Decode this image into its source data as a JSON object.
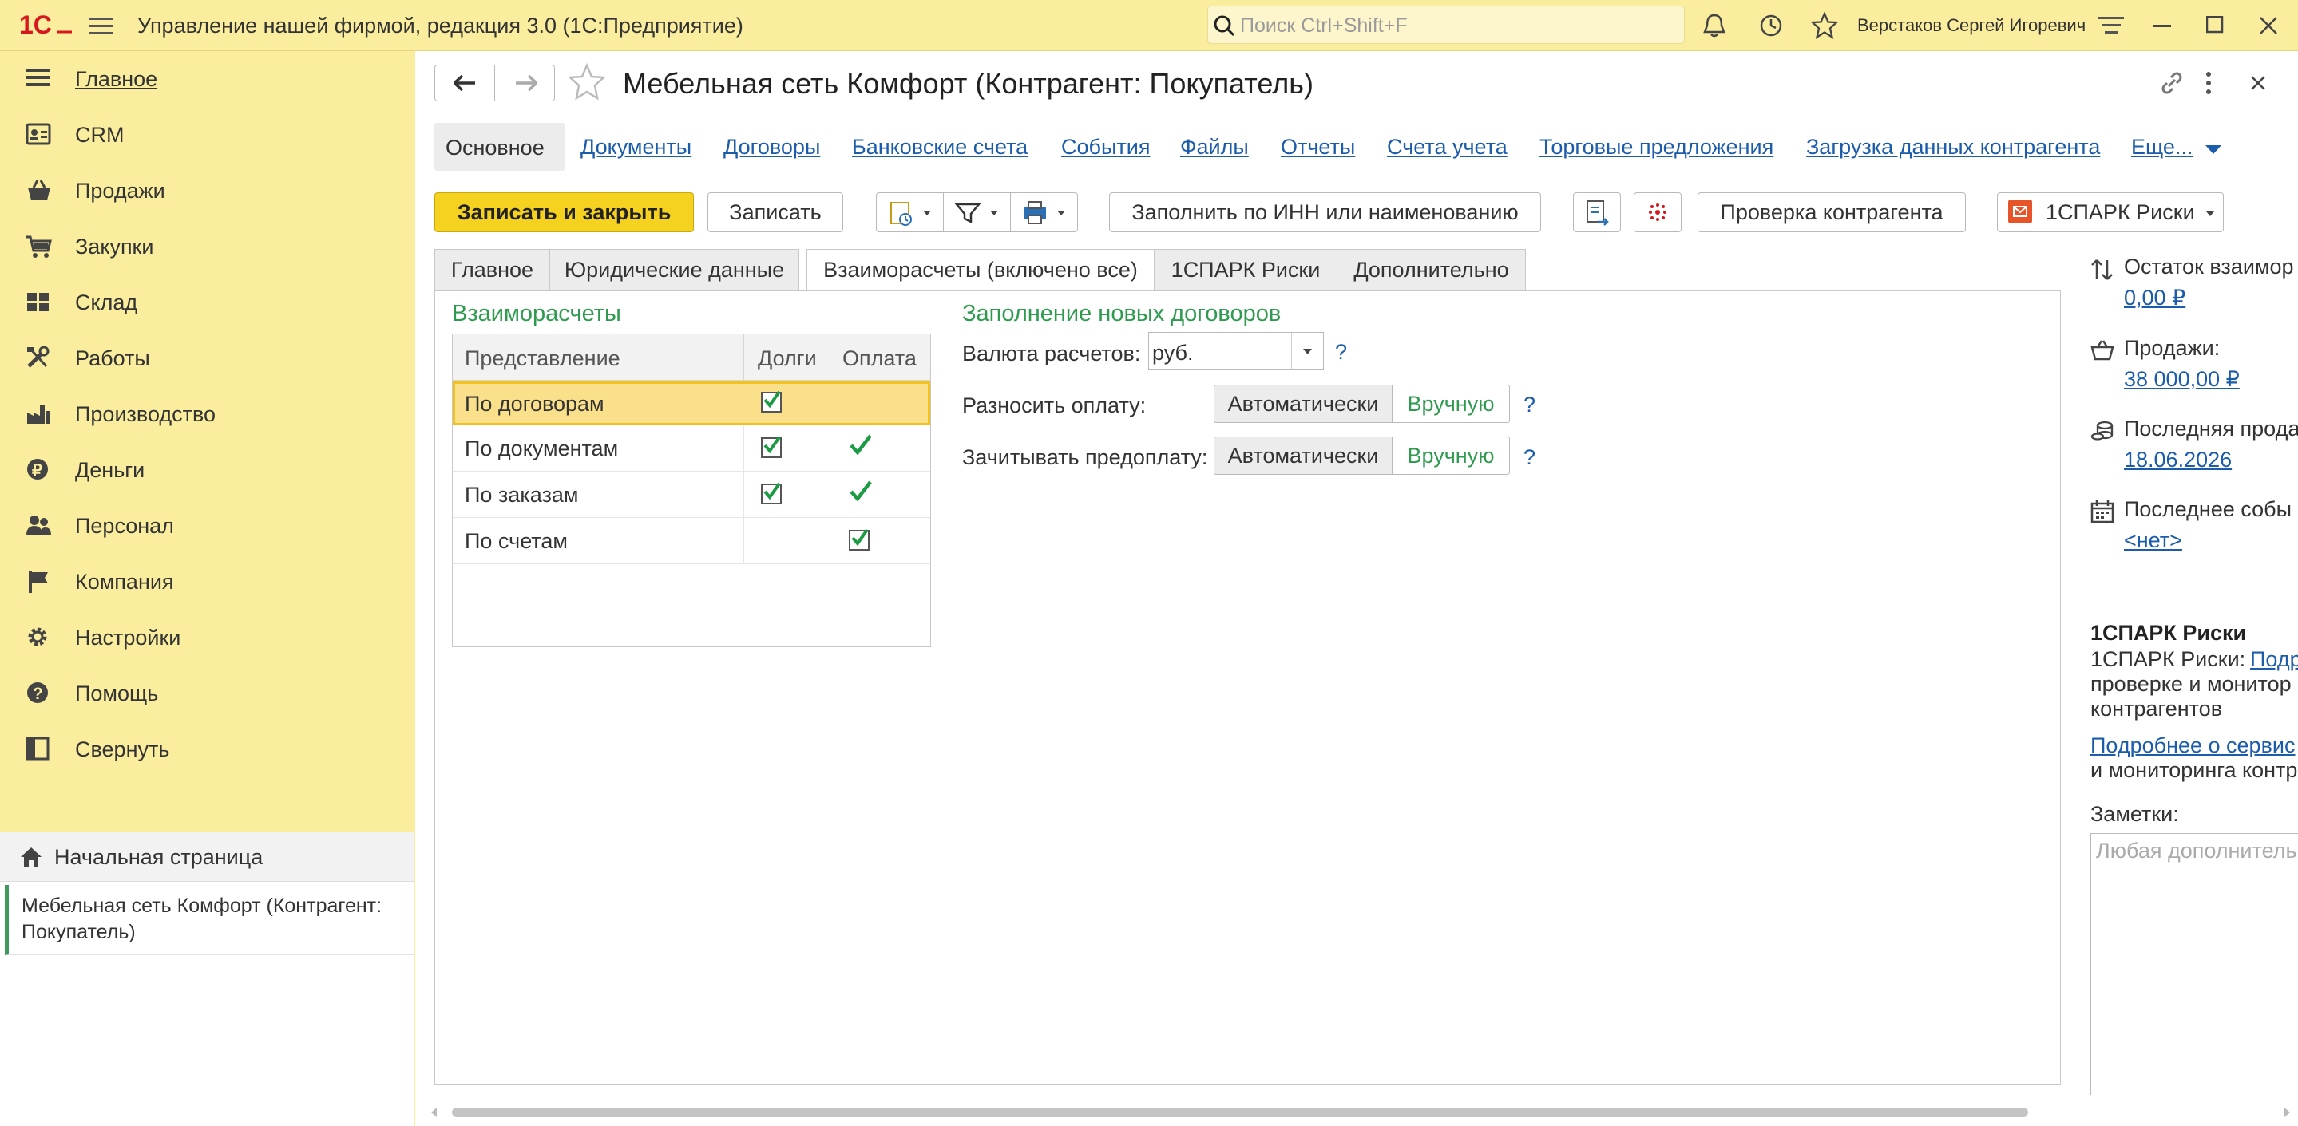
{
  "titlebar": {
    "logo": "1С",
    "app_title": "Управление нашей фирмой, редакция 3.0  (1С:Предприятие)",
    "search_placeholder": "Поиск Ctrl+Shift+F",
    "user_name": "Верстаков Сергей Игоревич"
  },
  "sidebar": {
    "items": [
      {
        "label": "Главное",
        "icon": "list-icon"
      },
      {
        "label": "CRM",
        "icon": "contacts-icon"
      },
      {
        "label": "Продажи",
        "icon": "basket-icon"
      },
      {
        "label": "Закупки",
        "icon": "cart-icon"
      },
      {
        "label": "Склад",
        "icon": "warehouse-icon"
      },
      {
        "label": "Работы",
        "icon": "tools-icon"
      },
      {
        "label": "Производство",
        "icon": "factory-icon"
      },
      {
        "label": "Деньги",
        "icon": "ruble-icon"
      },
      {
        "label": "Персонал",
        "icon": "people-icon"
      },
      {
        "label": "Компания",
        "icon": "flag-icon"
      },
      {
        "label": "Настройки",
        "icon": "gear-icon"
      },
      {
        "label": "Помощь",
        "icon": "help-icon"
      },
      {
        "label": "Свернуть",
        "icon": "collapse-icon"
      }
    ],
    "home_label": "Начальная страница",
    "open_doc_label": "Мебельная сеть Комфорт (Контрагент: Покупатель)"
  },
  "form": {
    "title": "Мебельная сеть Комфорт (Контрагент: Покупатель)",
    "sections": [
      "Основное",
      "Документы",
      "Договоры",
      "Банковские счета",
      "События",
      "Файлы",
      "Отчеты",
      "Счета учета",
      "Торговые предложения",
      "Загрузка данных контрагента",
      "Еще..."
    ],
    "toolbar": {
      "save_close": "Записать и закрыть",
      "save": "Записать",
      "fill_inn": "Заполнить по ИНН или наименованию",
      "check": "Проверка контрагента",
      "spark": "1СПАРК Риски"
    },
    "tabs": [
      "Главное",
      "Юридические данные",
      "Взаиморасчеты (включено все)",
      "1СПАРК Риски",
      "Дополнительно"
    ],
    "settlements": {
      "heading": "Взаиморасчеты",
      "columns": [
        "Представление",
        "Долги",
        "Оплата"
      ],
      "rows": [
        {
          "name": "По договорам",
          "debts": true,
          "payment": false
        },
        {
          "name": "По документам",
          "debts": true,
          "payment": true
        },
        {
          "name": "По заказам",
          "debts": true,
          "payment": true
        },
        {
          "name": "По счетам",
          "debts": false,
          "payment": true
        }
      ]
    },
    "new_contracts": {
      "heading": "Заполнение новых договоров",
      "currency_label": "Валюта расчетов:",
      "currency_value": "руб.",
      "spread_label": "Разносить оплату:",
      "offset_label": "Зачитывать предоплату:",
      "auto": "Автоматически",
      "manual": "Вручную",
      "help": "?"
    }
  },
  "right_panel": {
    "balance_label": "Остаток взаимор",
    "balance_value": "0,00 ₽",
    "sales_label": "Продажи:",
    "sales_value": "38 000,00 ₽",
    "last_sale_label": "Последняя прода",
    "last_sale_value": "18.06.2026",
    "last_event_label": "Последнее собы",
    "last_event_value": "<нет>",
    "spark_heading": "1СПАРК Риски",
    "spark_text_1": "1СПАРК Риски: ",
    "spark_link_1": "Подр",
    "spark_text_2": "проверке и монитор",
    "spark_text_3": "контрагентов",
    "spark_link_2": "Подробнее о сервис",
    "spark_text_4": "и мониторинга контр",
    "notes_label": "Заметки:",
    "notes_placeholder": "Любая дополнитель"
  }
}
